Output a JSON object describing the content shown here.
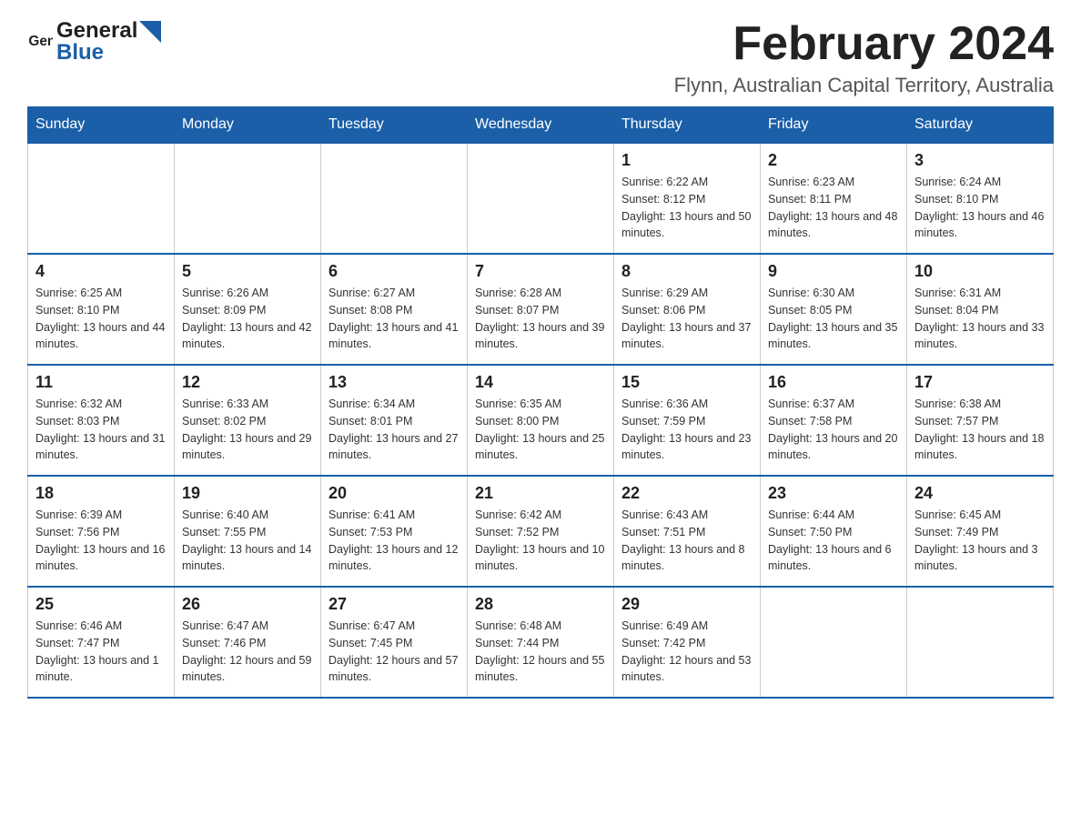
{
  "logo": {
    "text_general": "General",
    "text_blue": "Blue"
  },
  "header": {
    "month": "February 2024",
    "location": "Flynn, Australian Capital Territory, Australia"
  },
  "weekdays": [
    "Sunday",
    "Monday",
    "Tuesday",
    "Wednesday",
    "Thursday",
    "Friday",
    "Saturday"
  ],
  "weeks": [
    [
      {
        "day": "",
        "info": ""
      },
      {
        "day": "",
        "info": ""
      },
      {
        "day": "",
        "info": ""
      },
      {
        "day": "",
        "info": ""
      },
      {
        "day": "1",
        "info": "Sunrise: 6:22 AM\nSunset: 8:12 PM\nDaylight: 13 hours and 50 minutes."
      },
      {
        "day": "2",
        "info": "Sunrise: 6:23 AM\nSunset: 8:11 PM\nDaylight: 13 hours and 48 minutes."
      },
      {
        "day": "3",
        "info": "Sunrise: 6:24 AM\nSunset: 8:10 PM\nDaylight: 13 hours and 46 minutes."
      }
    ],
    [
      {
        "day": "4",
        "info": "Sunrise: 6:25 AM\nSunset: 8:10 PM\nDaylight: 13 hours and 44 minutes."
      },
      {
        "day": "5",
        "info": "Sunrise: 6:26 AM\nSunset: 8:09 PM\nDaylight: 13 hours and 42 minutes."
      },
      {
        "day": "6",
        "info": "Sunrise: 6:27 AM\nSunset: 8:08 PM\nDaylight: 13 hours and 41 minutes."
      },
      {
        "day": "7",
        "info": "Sunrise: 6:28 AM\nSunset: 8:07 PM\nDaylight: 13 hours and 39 minutes."
      },
      {
        "day": "8",
        "info": "Sunrise: 6:29 AM\nSunset: 8:06 PM\nDaylight: 13 hours and 37 minutes."
      },
      {
        "day": "9",
        "info": "Sunrise: 6:30 AM\nSunset: 8:05 PM\nDaylight: 13 hours and 35 minutes."
      },
      {
        "day": "10",
        "info": "Sunrise: 6:31 AM\nSunset: 8:04 PM\nDaylight: 13 hours and 33 minutes."
      }
    ],
    [
      {
        "day": "11",
        "info": "Sunrise: 6:32 AM\nSunset: 8:03 PM\nDaylight: 13 hours and 31 minutes."
      },
      {
        "day": "12",
        "info": "Sunrise: 6:33 AM\nSunset: 8:02 PM\nDaylight: 13 hours and 29 minutes."
      },
      {
        "day": "13",
        "info": "Sunrise: 6:34 AM\nSunset: 8:01 PM\nDaylight: 13 hours and 27 minutes."
      },
      {
        "day": "14",
        "info": "Sunrise: 6:35 AM\nSunset: 8:00 PM\nDaylight: 13 hours and 25 minutes."
      },
      {
        "day": "15",
        "info": "Sunrise: 6:36 AM\nSunset: 7:59 PM\nDaylight: 13 hours and 23 minutes."
      },
      {
        "day": "16",
        "info": "Sunrise: 6:37 AM\nSunset: 7:58 PM\nDaylight: 13 hours and 20 minutes."
      },
      {
        "day": "17",
        "info": "Sunrise: 6:38 AM\nSunset: 7:57 PM\nDaylight: 13 hours and 18 minutes."
      }
    ],
    [
      {
        "day": "18",
        "info": "Sunrise: 6:39 AM\nSunset: 7:56 PM\nDaylight: 13 hours and 16 minutes."
      },
      {
        "day": "19",
        "info": "Sunrise: 6:40 AM\nSunset: 7:55 PM\nDaylight: 13 hours and 14 minutes."
      },
      {
        "day": "20",
        "info": "Sunrise: 6:41 AM\nSunset: 7:53 PM\nDaylight: 13 hours and 12 minutes."
      },
      {
        "day": "21",
        "info": "Sunrise: 6:42 AM\nSunset: 7:52 PM\nDaylight: 13 hours and 10 minutes."
      },
      {
        "day": "22",
        "info": "Sunrise: 6:43 AM\nSunset: 7:51 PM\nDaylight: 13 hours and 8 minutes."
      },
      {
        "day": "23",
        "info": "Sunrise: 6:44 AM\nSunset: 7:50 PM\nDaylight: 13 hours and 6 minutes."
      },
      {
        "day": "24",
        "info": "Sunrise: 6:45 AM\nSunset: 7:49 PM\nDaylight: 13 hours and 3 minutes."
      }
    ],
    [
      {
        "day": "25",
        "info": "Sunrise: 6:46 AM\nSunset: 7:47 PM\nDaylight: 13 hours and 1 minute."
      },
      {
        "day": "26",
        "info": "Sunrise: 6:47 AM\nSunset: 7:46 PM\nDaylight: 12 hours and 59 minutes."
      },
      {
        "day": "27",
        "info": "Sunrise: 6:47 AM\nSunset: 7:45 PM\nDaylight: 12 hours and 57 minutes."
      },
      {
        "day": "28",
        "info": "Sunrise: 6:48 AM\nSunset: 7:44 PM\nDaylight: 12 hours and 55 minutes."
      },
      {
        "day": "29",
        "info": "Sunrise: 6:49 AM\nSunset: 7:42 PM\nDaylight: 12 hours and 53 minutes."
      },
      {
        "day": "",
        "info": ""
      },
      {
        "day": "",
        "info": ""
      }
    ]
  ]
}
